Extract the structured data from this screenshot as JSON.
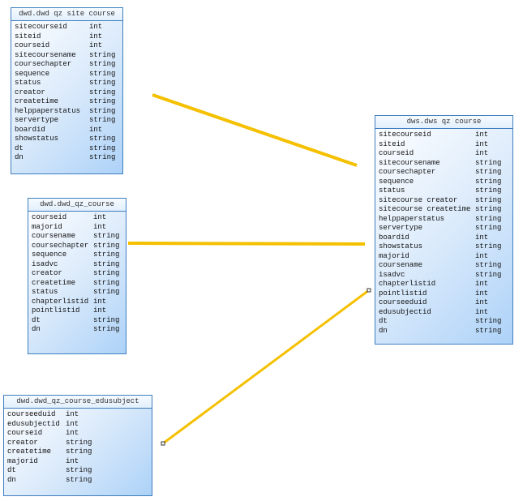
{
  "colors": {
    "connector": "#f5c000",
    "table_border": "#3f7fbf"
  },
  "tables": [
    {
      "title": "dwd.dwd qz site course",
      "columns": [
        [
          "sitecourseid",
          "int"
        ],
        [
          "siteid",
          "int"
        ],
        [
          "courseid",
          "int"
        ],
        [
          "sitecoursename",
          "string"
        ],
        [
          "coursechapter",
          "string"
        ],
        [
          "sequence",
          "string"
        ],
        [
          "status",
          "string"
        ],
        [
          "creator",
          "string"
        ],
        [
          "createtime",
          "string"
        ],
        [
          "helppaperstatus",
          "string"
        ],
        [
          "servertype",
          "string"
        ],
        [
          "boardid",
          "int"
        ],
        [
          "showstatus",
          "string"
        ],
        [
          "dt",
          "string"
        ],
        [
          "dn",
          "string"
        ]
      ]
    },
    {
      "title": "dwd.dwd_qz_course",
      "columns": [
        [
          "courseid",
          "int"
        ],
        [
          "majorid",
          "int"
        ],
        [
          "coursename",
          "string"
        ],
        [
          "coursechapter",
          "string"
        ],
        [
          "sequence",
          "string"
        ],
        [
          "isadvc",
          "string"
        ],
        [
          "creator",
          "string"
        ],
        [
          "createtime",
          "string"
        ],
        [
          "status",
          "string"
        ],
        [
          "chapterlistid",
          "int"
        ],
        [
          "pointlistid",
          "int"
        ],
        [
          "dt",
          "string"
        ],
        [
          "dn",
          "string"
        ]
      ]
    },
    {
      "title": "dwd.dwd_qz_course_edusubject",
      "columns": [
        [
          "courseeduid",
          "int"
        ],
        [
          "edusubjectid",
          "int"
        ],
        [
          "courseid",
          "int"
        ],
        [
          "creator",
          "string"
        ],
        [
          "createtime",
          "string"
        ],
        [
          "majorid",
          "int"
        ],
        [
          "dt",
          "string"
        ],
        [
          "dn",
          "string"
        ]
      ]
    },
    {
      "title": "dws.dws qz course",
      "columns": [
        [
          "sitecourseid",
          "int"
        ],
        [
          "siteid",
          "int"
        ],
        [
          "courseid",
          "int"
        ],
        [
          "sitecoursename",
          "string"
        ],
        [
          "coursechapter",
          "string"
        ],
        [
          "sequence",
          "string"
        ],
        [
          "status",
          "string"
        ],
        [
          "sitecourse creator",
          "string"
        ],
        [
          "sitecourse createtime",
          "string"
        ],
        [
          "helppaperstatus",
          "string"
        ],
        [
          "servertype",
          "string"
        ],
        [
          "boardid",
          "int"
        ],
        [
          "showstatus",
          "string"
        ],
        [
          "majorid",
          "int"
        ],
        [
          "coursename",
          "string"
        ],
        [
          "isadvc",
          "string"
        ],
        [
          "chapterlistid",
          "int"
        ],
        [
          "pointlistid",
          "int"
        ],
        [
          "courseeduid",
          "int"
        ],
        [
          "edusubjectid",
          "int"
        ],
        [
          "dt",
          "string"
        ],
        [
          "dn",
          "string"
        ]
      ]
    }
  ]
}
